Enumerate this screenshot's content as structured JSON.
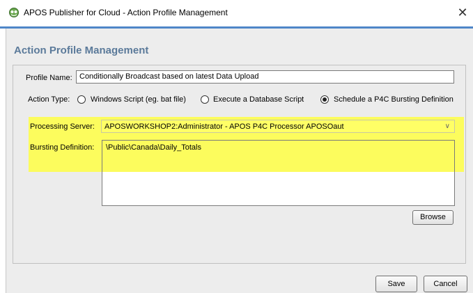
{
  "window": {
    "title": "APOS Publisher for Cloud - Action Profile Management",
    "close_glyph": "✕",
    "icon": "apos-publisher-icon"
  },
  "heading": "Action Profile Management",
  "profile": {
    "label": "Profile Name:",
    "value": "Conditionally Broadcast based on latest Data Upload"
  },
  "action_type": {
    "label": "Action Type:",
    "options": [
      {
        "label": "Windows Script (eg. bat file)",
        "selected": false
      },
      {
        "label": "Execute a Database Script",
        "selected": false
      },
      {
        "label": "Schedule a P4C Bursting Definition",
        "selected": true
      }
    ]
  },
  "processing_server": {
    "label": "Processing Server:",
    "value": "APOSWORKSHOP2:Administrator - APOS P4C Processor APOSOaut"
  },
  "bursting": {
    "label": "Bursting Definition:",
    "value": "\\Public\\Canada\\Daily_Totals"
  },
  "buttons": {
    "browse": "Browse",
    "save": "Save",
    "cancel": "Cancel"
  },
  "colors": {
    "highlight": "#ffff44",
    "accent": "#4f86c8",
    "heading": "#5b7a9a"
  }
}
